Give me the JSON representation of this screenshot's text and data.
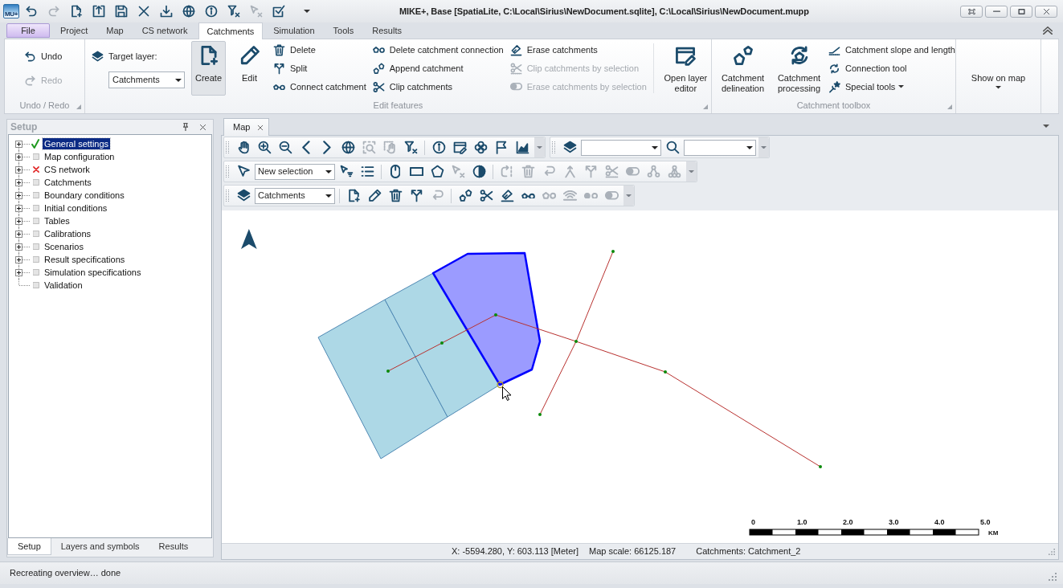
{
  "app_logo": {
    "text": "MU+"
  },
  "quick_access": [
    {
      "disabled": false
    },
    {
      "disabled": true
    },
    {
      "disabled": false
    },
    {
      "disabled": false
    },
    {
      "disabled": false
    },
    {
      "disabled": false
    },
    {
      "disabled": false
    },
    {
      "disabled": false
    },
    {
      "disabled": false
    },
    {
      "disabled": false
    },
    {
      "disabled": true
    },
    {
      "disabled": false
    }
  ],
  "window": {
    "title": "MIKE+, Base [SpatiaLite, C:\\Local\\Sirius\\NewDocument.sqlite], C:\\Local\\Sirius\\NewDocument.mupp"
  },
  "ribbon": {
    "tabs": [
      {
        "label": "File",
        "kind": "file",
        "selected": false
      },
      {
        "label": "Project",
        "kind": "tab",
        "selected": false
      },
      {
        "label": "Map",
        "kind": "tab",
        "selected": false
      },
      {
        "label": "CS network",
        "kind": "tab",
        "selected": false
      },
      {
        "label": "Catchments",
        "kind": "tab",
        "selected": true
      },
      {
        "label": "Simulation",
        "kind": "tab",
        "selected": false
      },
      {
        "label": "Tools",
        "kind": "tab",
        "selected": false
      },
      {
        "label": "Results",
        "kind": "tab",
        "selected": false
      }
    ],
    "groups": [
      {
        "title": "Undo / Redo",
        "items": [
          {
            "kind": "small",
            "label": "Undo",
            "disabled": false,
            "menu": false
          },
          {
            "kind": "small",
            "label": "Redo",
            "disabled": true,
            "menu": false
          }
        ]
      },
      {
        "title": "Edit features",
        "items": [
          {
            "kind": "layer_picker",
            "label": "Target layer:",
            "value": "Catchments"
          },
          {
            "kind": "large",
            "label": "Create",
            "selected": true,
            "menu": false
          },
          {
            "kind": "large",
            "label": "Edit",
            "selected": false,
            "menu": false
          },
          {
            "kind": "small",
            "label": "Delete",
            "disabled": false,
            "menu": false
          },
          {
            "kind": "small",
            "label": "Split",
            "disabled": false,
            "menu": false
          },
          {
            "kind": "small",
            "label": "Connect catchment",
            "disabled": false,
            "menu": false
          },
          {
            "kind": "small",
            "label": "Delete catchment connection",
            "disabled": false,
            "menu": false
          },
          {
            "kind": "small",
            "label": "Append catchment",
            "disabled": false,
            "menu": false
          },
          {
            "kind": "small",
            "label": "Clip catchments",
            "disabled": false,
            "menu": false
          },
          {
            "kind": "small",
            "label": "Erase catchments",
            "disabled": false,
            "menu": false
          },
          {
            "kind": "small",
            "label": "Clip catchments by selection",
            "disabled": true,
            "menu": false
          },
          {
            "kind": "small",
            "label": "Erase catchments by selection",
            "disabled": true,
            "menu": false
          },
          {
            "kind": "large",
            "label": "Open layer editor",
            "selected": false,
            "menu": false
          }
        ]
      },
      {
        "title": "Catchment toolbox",
        "items": [
          {
            "kind": "large",
            "label": "Catchment delineation",
            "selected": false,
            "menu": false
          },
          {
            "kind": "large",
            "label": "Catchment processing",
            "selected": false,
            "menu": false
          },
          {
            "kind": "small",
            "label": "Catchment slope and length",
            "disabled": false,
            "menu": false
          },
          {
            "kind": "small",
            "label": "Connection tool",
            "disabled": false,
            "menu": false
          },
          {
            "kind": "small",
            "label": "Special tools",
            "disabled": false,
            "menu": true
          }
        ]
      },
      {
        "items": [
          {
            "kind": "large",
            "label": "Show on map",
            "selected": false,
            "menu": true
          }
        ]
      }
    ]
  },
  "setup_panel": {
    "title": "Setup",
    "tree": [
      {
        "label": "General settings",
        "valid": true,
        "invalid": false,
        "expandable": true,
        "selected": true
      },
      {
        "label": "Map configuration",
        "valid": false,
        "invalid": false,
        "expandable": true,
        "selected": false
      },
      {
        "label": "CS network",
        "valid": false,
        "invalid": true,
        "expandable": true,
        "selected": false
      },
      {
        "label": "Catchments",
        "valid": false,
        "invalid": false,
        "expandable": true,
        "selected": false
      },
      {
        "label": "Boundary conditions",
        "valid": false,
        "invalid": false,
        "expandable": true,
        "selected": false
      },
      {
        "label": "Initial conditions",
        "valid": false,
        "invalid": false,
        "expandable": true,
        "selected": false
      },
      {
        "label": "Tables",
        "valid": false,
        "invalid": false,
        "expandable": true,
        "selected": false
      },
      {
        "label": "Calibrations",
        "valid": false,
        "invalid": false,
        "expandable": true,
        "selected": false
      },
      {
        "label": "Scenarios",
        "valid": false,
        "invalid": false,
        "expandable": true,
        "selected": false
      },
      {
        "label": "Result specifications",
        "valid": false,
        "invalid": false,
        "expandable": true,
        "selected": false
      },
      {
        "label": "Simulation specifications",
        "valid": false,
        "invalid": false,
        "expandable": true,
        "selected": false
      },
      {
        "label": "Validation",
        "valid": false,
        "invalid": false,
        "expandable": false,
        "selected": false
      }
    ],
    "tabs": [
      {
        "label": "Setup",
        "selected": true
      },
      {
        "label": "Layers and symbols",
        "selected": false
      },
      {
        "label": "Results",
        "selected": false
      }
    ]
  },
  "map_view": {
    "tab": {
      "label": "Map"
    },
    "toolbars": [
      {
        "items": [
          {
            "kind": "button",
            "disabled": false
          },
          {
            "kind": "button",
            "disabled": false
          },
          {
            "kind": "button",
            "disabled": false
          },
          {
            "kind": "button",
            "disabled": false
          },
          {
            "kind": "button",
            "disabled": false
          },
          {
            "kind": "button",
            "disabled": false
          },
          {
            "kind": "button",
            "disabled": true
          },
          {
            "kind": "button",
            "disabled": true
          },
          {
            "kind": "button",
            "disabled": false
          },
          {
            "kind": "button",
            "disabled": false
          },
          {
            "kind": "button",
            "disabled": false
          },
          {
            "kind": "button",
            "disabled": false
          },
          {
            "kind": "button",
            "disabled": false
          },
          {
            "kind": "button",
            "disabled": false
          }
        ]
      },
      {
        "items": [
          {
            "kind": "button",
            "disabled": false
          },
          {
            "kind": "dropdown"
          },
          {
            "kind": "button",
            "disabled": false
          },
          {
            "kind": "dropdown"
          }
        ]
      },
      {
        "items": [
          {
            "kind": "button",
            "disabled": false
          },
          {
            "kind": "dropdown",
            "value": "New selection"
          },
          {
            "kind": "button",
            "disabled": false
          },
          {
            "kind": "button",
            "disabled": false
          },
          {
            "kind": "button",
            "disabled": false
          },
          {
            "kind": "button",
            "disabled": false
          },
          {
            "kind": "button",
            "disabled": false
          },
          {
            "kind": "button",
            "disabled": true
          },
          {
            "kind": "button",
            "disabled": false
          },
          {
            "kind": "button",
            "disabled": true
          },
          {
            "kind": "button",
            "disabled": true
          },
          {
            "kind": "button",
            "disabled": true
          },
          {
            "kind": "button",
            "disabled": true
          },
          {
            "kind": "button",
            "disabled": true
          },
          {
            "kind": "button",
            "disabled": true
          },
          {
            "kind": "button",
            "disabled": true
          },
          {
            "kind": "button",
            "disabled": true
          },
          {
            "kind": "button",
            "disabled": true
          }
        ]
      },
      {
        "items": [
          {
            "kind": "button",
            "disabled": false
          },
          {
            "kind": "dropdown",
            "value": "Catchments"
          },
          {
            "kind": "button",
            "disabled": false
          },
          {
            "kind": "button",
            "disabled": false
          },
          {
            "kind": "button",
            "disabled": false
          },
          {
            "kind": "button",
            "disabled": false
          },
          {
            "kind": "button",
            "disabled": true
          },
          {
            "kind": "button",
            "disabled": false
          },
          {
            "kind": "button",
            "disabled": false
          },
          {
            "kind": "button",
            "disabled": false
          },
          {
            "kind": "button",
            "disabled": false
          },
          {
            "kind": "button",
            "disabled": true
          },
          {
            "kind": "button",
            "disabled": true
          },
          {
            "kind": "button",
            "disabled": true
          },
          {
            "kind": "button",
            "disabled": true
          }
        ]
      }
    ],
    "catchments": [
      {
        "selected": false
      },
      {
        "selected": false
      },
      {
        "selected": true
      }
    ],
    "scale_bar": {
      "labels": [
        "0",
        "1.0",
        "2.0",
        "3.0",
        "4.0",
        "5.0"
      ],
      "unit": "KM"
    },
    "status": [
      "X: -5594.280, Y: 603.113 [Meter]",
      "Map scale: 66125.187",
      "Catchments: Catchment_2"
    ]
  },
  "status_bar": {
    "text": "Recreating overview… done"
  }
}
